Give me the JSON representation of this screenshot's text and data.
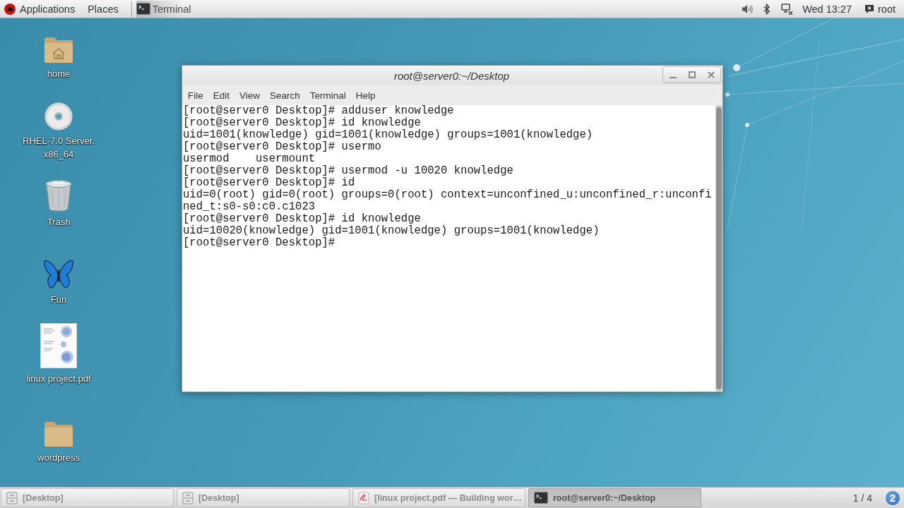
{
  "top_panel": {
    "applications_menu": "Applications",
    "places_menu": "Places",
    "active_app": "Terminal",
    "clock": "Wed 13:27",
    "user": "root"
  },
  "desktop_icons": [
    {
      "kind": "home-folder",
      "label": "home"
    },
    {
      "kind": "disc",
      "label": "RHEL-7.0 Server.\nx86_64"
    },
    {
      "kind": "trash",
      "label": "Trash"
    },
    {
      "kind": "butterfly",
      "label": "Fun"
    },
    {
      "kind": "document",
      "label": "linux project.pdf"
    },
    {
      "kind": "folder",
      "label": "wordpress"
    }
  ],
  "terminal_window": {
    "title": "root@server0:~/Desktop",
    "menu": [
      "File",
      "Edit",
      "View",
      "Search",
      "Terminal",
      "Help"
    ],
    "lines": [
      "[root@server0 Desktop]# adduser knowledge",
      "[root@server0 Desktop]# id knowledge",
      "uid=1001(knowledge) gid=1001(knowledge) groups=1001(knowledge)",
      "[root@server0 Desktop]# usermo",
      "usermod    usermount",
      "[root@server0 Desktop]# usermod -u 10020 knowledge",
      "[root@server0 Desktop]# id",
      "uid=0(root) gid=0(root) groups=0(root) context=unconfined_u:unconfined_r:unconfi",
      "ned_t:s0-s0:c0.c1023",
      "[root@server0 Desktop]# id knowledge",
      "uid=10020(knowledge) gid=1001(knowledge) groups=1001(knowledge)",
      "[root@server0 Desktop]#"
    ]
  },
  "taskbar": {
    "items": [
      {
        "kind": "folder",
        "label": "[Desktop]",
        "selected": false
      },
      {
        "kind": "folder",
        "label": "[Desktop]",
        "selected": false
      },
      {
        "kind": "pdf",
        "label": "[linux project.pdf — Building wor…",
        "selected": false
      },
      {
        "kind": "terminal",
        "label": "root@server0:~/Desktop",
        "selected": true
      }
    ],
    "workspace": "1 / 4",
    "notification_count": "2"
  }
}
